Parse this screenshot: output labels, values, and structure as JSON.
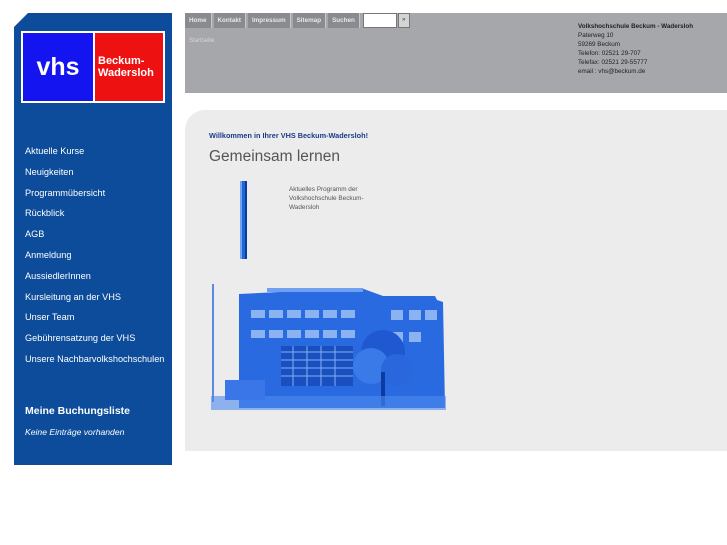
{
  "sidebar": {
    "logo": {
      "vhs": "vhs",
      "place_line1": "Beckum-",
      "place_line2": "Wadersloh"
    },
    "items": [
      {
        "label": "Aktuelle Kurse"
      },
      {
        "label": "Neuigkeiten"
      },
      {
        "label": "Programmübersicht"
      },
      {
        "label": "Rückblick"
      },
      {
        "label": "AGB"
      },
      {
        "label": "Anmeldung"
      },
      {
        "label": "AussiedlerInnen"
      },
      {
        "label": "Kursleitung an der VHS"
      },
      {
        "label": "Unser Team"
      },
      {
        "label": "Gebührensatzung der VHS"
      },
      {
        "label": "Unsere Nachbarvolkshochschulen"
      }
    ],
    "booking_title": "Meine Buchungsliste",
    "booking_empty": "Keine Einträge vorhanden"
  },
  "header": {
    "nav": [
      {
        "label": "Home"
      },
      {
        "label": "Kontakt"
      },
      {
        "label": "Impressum"
      },
      {
        "label": "Sitemap"
      },
      {
        "label": "Suchen"
      }
    ],
    "search": {
      "value": "",
      "go_label": "»"
    },
    "breadcrumb": "Startseite",
    "address": {
      "org": "Volkshochschule Beckum - Wadersloh",
      "street": "Paterweg 10",
      "city": "59269 Beckum",
      "phone": "Telefon: 02521 29-707",
      "fax": "Telefax: 02521 29-55777",
      "email": "email : vhs@beckum.de"
    }
  },
  "content": {
    "welcome": "Willkommen in Ihrer VHS Beckum-Wadersloh!",
    "headline": "Gemeinsam lernen",
    "teaser": "Aktuelles Programm der Volkshochschule Beckum-Wadersloh"
  },
  "colors": {
    "sidebar": "#0c4c9a",
    "logo_blue": "#1414f0",
    "logo_red": "#ee1111",
    "header": "#a6a7ab",
    "content_bg": "#ececec",
    "accent": "#1f66d8"
  },
  "icons": {
    "search_go": "chevron-right-icon"
  }
}
